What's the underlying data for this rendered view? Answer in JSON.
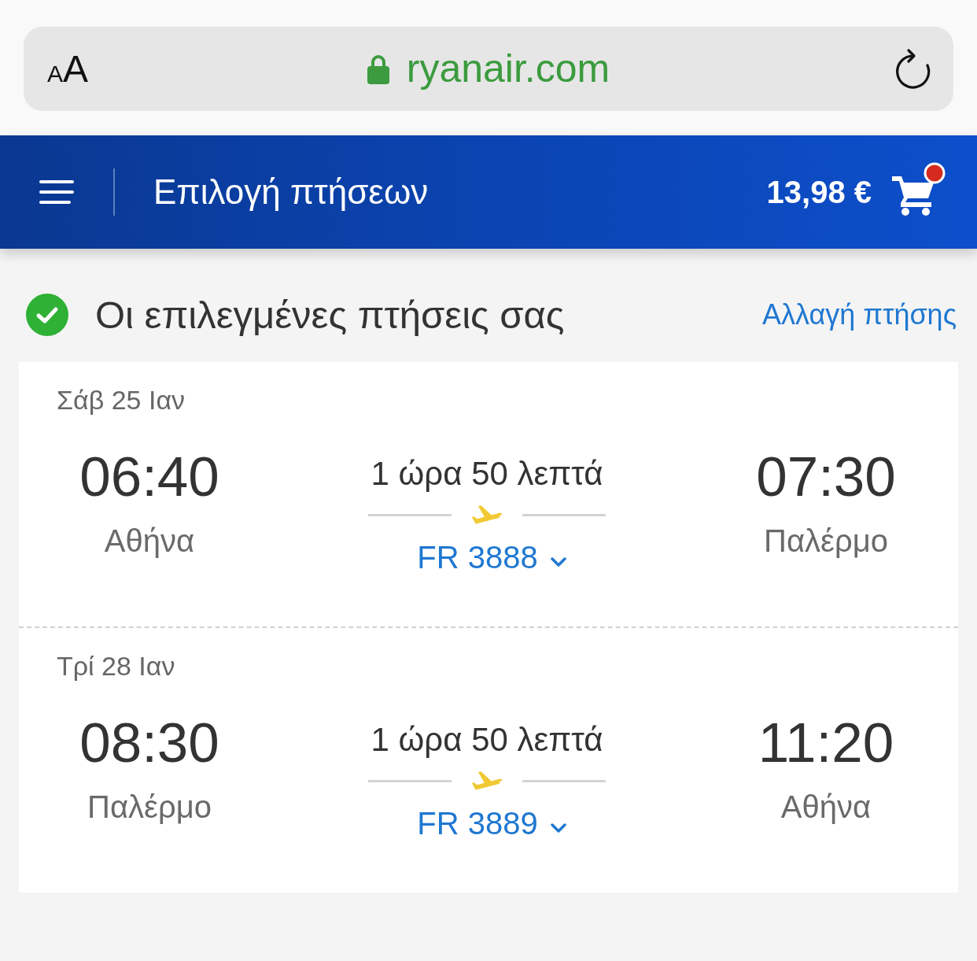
{
  "browser": {
    "text_size_button": [
      "A",
      "A"
    ],
    "secure": true,
    "url": "ryanair.com"
  },
  "header": {
    "title": "Επιλογή πτήσεων",
    "cart": {
      "price": "13,98 €",
      "badge": true
    }
  },
  "selected_flights": {
    "title": "Οι επιλεγμένες πτήσεις σας",
    "change_link": "Αλλαγή πτήσης",
    "legs": [
      {
        "date": "Σάβ 25 Ιαν",
        "departure_time": "06:40",
        "departure_city": "Αθήνα",
        "duration": "1 ώρα 50 λεπτά",
        "flight_number": "FR 3888",
        "expanded": false,
        "arrival_time": "07:30",
        "arrival_city": "Παλέρμο"
      },
      {
        "date": "Τρί 28 Ιαν",
        "departure_time": "08:30",
        "departure_city": "Παλέρμο",
        "duration": "1 ώρα 50 λεπτά",
        "flight_number": "FR 3889",
        "expanded": false,
        "arrival_time": "11:20",
        "arrival_city": "Αθήνα"
      }
    ]
  }
}
